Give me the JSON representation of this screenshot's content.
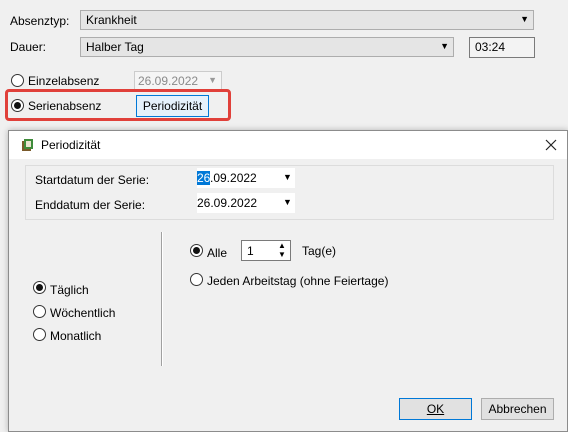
{
  "form": {
    "absenztyp_label": "Absenztyp:",
    "absenztyp_value": "Krankheit",
    "dauer_label": "Dauer:",
    "dauer_value": "Halber Tag",
    "time_value": "03:24",
    "einzelabsenz_label": "Einzelabsenz",
    "einzelabsenz_date": "26.09.2022",
    "serienabsenz_label": "Serienabsenz",
    "periodizitaet_button": "Periodizität"
  },
  "dialog": {
    "title": "Periodizität",
    "start_label": "Startdatum der Serie:",
    "start_date_highlight": "26",
    "start_date_rest": ".09.2022",
    "end_label": "Enddatum der Serie:",
    "end_date": "26.09.2022",
    "freq": {
      "taeglich": "Täglich",
      "woechentlich": "Wöchentlich",
      "monatlich": "Monatlich"
    },
    "alle_label": "Alle",
    "alle_value": "1",
    "tage_label": "Tag(e)",
    "arbeitstag_label": "Jeden Arbeitstag (ohne Feiertage)",
    "ok_label": "OK",
    "abbrechen_label": "Abbrechen"
  },
  "colors": {
    "highlight_box": "#e0403a",
    "selection": "#0078d7",
    "focus_border": "#0078d7"
  }
}
